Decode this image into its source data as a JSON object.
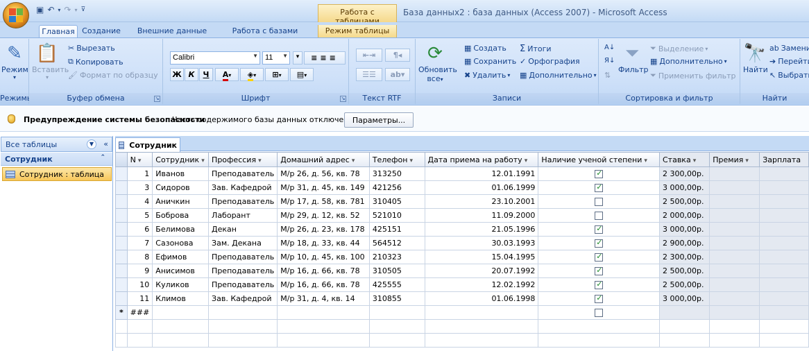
{
  "window": {
    "title": "База данных2 : база данных (Access 2007) - Microsoft Access",
    "contextual_group": "Работа с таблицами"
  },
  "tabs": [
    {
      "label": "Главная"
    },
    {
      "label": "Создание"
    },
    {
      "label": "Внешние данные"
    },
    {
      "label": "Работа с базами данных"
    },
    {
      "label": "Режим таблицы"
    }
  ],
  "ribbon": {
    "views": {
      "title": "Режимы",
      "mode_label": "Режим"
    },
    "clipboard": {
      "title": "Буфер обмена",
      "paste": "Вставить",
      "cut": "Вырезать",
      "copy": "Копировать",
      "format_painter": "Формат по образцу"
    },
    "font": {
      "title": "Шрифт",
      "font_name": "Calibri",
      "font_size": "11",
      "bold": "Ж",
      "italic": "К",
      "underline": "Ч",
      "font_color": "А"
    },
    "rich_text": {
      "title": "Текст RTF"
    },
    "records": {
      "title": "Записи",
      "refresh": "Обновить",
      "refresh_sub": "все",
      "create": "Создать",
      "save": "Сохранить",
      "delete": "Удалить",
      "totals": "Итоги",
      "spelling": "Орфография",
      "more": "Дополнительно"
    },
    "sort_filter": {
      "title": "Сортировка и фильтр",
      "filter": "Фильтр",
      "selection": "Выделение",
      "advanced": "Дополнительно",
      "apply": "Применить фильтр"
    },
    "find": {
      "title": "Найти",
      "find": "Найти",
      "replace": "Заменить",
      "goto": "Перейти",
      "select": "Выбрать"
    }
  },
  "security_bar": {
    "title": "Предупреждение системы безопасности",
    "message": "Часть содержимого базы данных отключено",
    "button": "Параметры..."
  },
  "nav_pane": {
    "header": "Все таблицы",
    "group": "Сотрудник",
    "item": "Сотрудник : таблица"
  },
  "document_tab": "Сотрудник",
  "table": {
    "columns": [
      "N",
      "Сотрудник",
      "Профессия",
      "Домашний адрес",
      "Телефон",
      "Дата приема на работу",
      "Наличие ученой степени",
      "Ставка",
      "Премия",
      "Зарплата"
    ],
    "rows": [
      {
        "n": "1",
        "name": "Иванов",
        "prof": "Преподаватель",
        "addr": "М/р 26, д. 56, кв. 78",
        "phone": "313250",
        "date": "12.01.1991",
        "degree": true,
        "rate": "2 300,00р."
      },
      {
        "n": "3",
        "name": "Сидоров",
        "prof": "Зав. Кафедрой",
        "addr": "М/р 31, д. 45, кв. 149",
        "phone": "421256",
        "date": "01.06.1999",
        "degree": true,
        "rate": "3 000,00р."
      },
      {
        "n": "4",
        "name": "Аничкин",
        "prof": "Преподаватель",
        "addr": "М/р 17, д. 58, кв. 781",
        "phone": "310405",
        "date": "23.10.2001",
        "degree": false,
        "rate": "2 500,00р."
      },
      {
        "n": "5",
        "name": "Боброва",
        "prof": "Лаборант",
        "addr": "М/р 29, д. 12, кв. 52",
        "phone": "521010",
        "date": "11.09.2000",
        "degree": false,
        "rate": "2 000,00р."
      },
      {
        "n": "6",
        "name": "Белимова",
        "prof": "Декан",
        "addr": "М/р 26, д. 23, кв. 178",
        "phone": "425151",
        "date": "21.05.1996",
        "degree": true,
        "rate": "3 000,00р."
      },
      {
        "n": "7",
        "name": "Сазонова",
        "prof": "Зам. Декана",
        "addr": "М/р 18, д. 33, кв. 44",
        "phone": "564512",
        "date": "30.03.1993",
        "degree": true,
        "rate": "2 900,00р."
      },
      {
        "n": "8",
        "name": "Ефимов",
        "prof": "Преподаватель",
        "addr": "М/р 10, д. 45, кв. 100",
        "phone": "210323",
        "date": "15.04.1995",
        "degree": true,
        "rate": "2 300,00р."
      },
      {
        "n": "9",
        "name": "Анисимов",
        "prof": "Преподаватель",
        "addr": "М/р 16, д. 66, кв. 78",
        "phone": "310505",
        "date": "20.07.1992",
        "degree": true,
        "rate": "2 500,00р."
      },
      {
        "n": "10",
        "name": "Куликов",
        "prof": "Преподаватель",
        "addr": "М/р 16, д. 66, кв. 78",
        "phone": "425555",
        "date": "12.02.1992",
        "degree": true,
        "rate": "2 500,00р."
      },
      {
        "n": "11",
        "name": "Климов",
        "prof": "Зав. Кафедрой",
        "addr": "М/р 31, д. 4, кв. 14",
        "phone": "310855",
        "date": "01.06.1998",
        "degree": true,
        "rate": "3 000,00р."
      }
    ],
    "new_row": {
      "marker": "*",
      "n": "###"
    }
  },
  "colors": {
    "ribbon_bg": "#cfe1f9",
    "accent": "#15428b",
    "nav_selected": "#f8c75b",
    "check": "#1d8a2a"
  }
}
